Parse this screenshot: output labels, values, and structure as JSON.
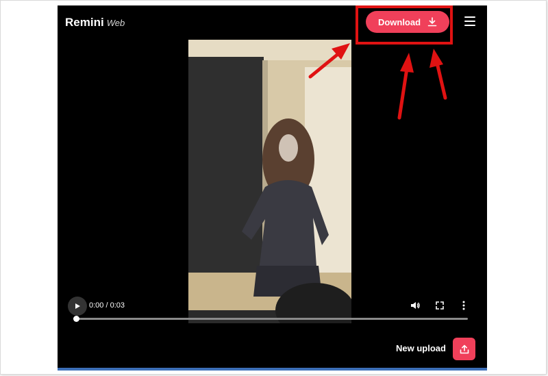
{
  "app": {
    "brand_name": "Remini",
    "brand_sub": "Web"
  },
  "header": {
    "download_label": "Download",
    "download_icon": "download-icon",
    "menu_icon": "hamburger-menu-icon",
    "accent_color": "#f0405a"
  },
  "player": {
    "time": "0:00 / 0:03",
    "progress_fraction": 0,
    "icons": [
      "play-icon",
      "volume-icon",
      "fullscreen-icon",
      "more-options-icon"
    ]
  },
  "footer": {
    "new_upload_label": "New upload",
    "upload_icon": "upload-icon"
  },
  "annotation": {
    "highlight_color": "#e01212",
    "arrow_icon": "red-arrow"
  }
}
